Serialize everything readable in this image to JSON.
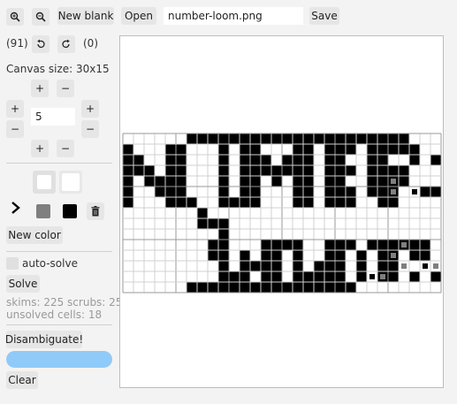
{
  "toolbar": {
    "zoom_in_icon": "zoom-in-icon",
    "zoom_out_icon": "zoom-out-icon",
    "new_blank_label": "New blank",
    "open_label": "Open",
    "filename_value": "number-loom.png",
    "save_label": "Save"
  },
  "history": {
    "undo_count": "(91)",
    "redo_count": "(0)"
  },
  "canvas_size": {
    "label": "Canvas size: 30x15",
    "resize_amount": "5",
    "plus": "+",
    "minus": "−"
  },
  "palette": {
    "colors": [
      "#ffffff",
      "#ffffff",
      "#7f7f7f",
      "#000000"
    ],
    "selected_marker": "›",
    "new_color_label": "New color"
  },
  "solver": {
    "auto_solve_label": "auto-solve",
    "auto_solve_checked": false,
    "solve_label": "Solve",
    "stats_line1": "skims: 225 scrubs: 25",
    "stats_line2": "unsolved cells: 18",
    "disambiguate_label": "Disambiguate!",
    "progress": 1.0,
    "clear_label": "Clear"
  },
  "colors": {
    "progress_bar": "#90caf9",
    "cell_black": "#000000",
    "cell_gray": "#7f7f7f",
    "cell_light": "#cccccc"
  },
  "grid": {
    "width": 30,
    "height": 15,
    "rows": [
      "000000000000000000000000000000",
      "100011000101100011011101111100",
      "110011000101110111011001100101",
      "111011000101111111011101111000",
      "101111000101101011011001111000",
      "100111000101100011011101110011",
      "100011100111100011011100110000",
      "000000010000000000000000000000",
      "000000011100000000000000000000",
      "000000000100000000000000000000",
      "000000001100011110011101111110",
      "000000001101011010011010110110",
      "000000000101111010111010110000",
      "000000000111011011111010110101",
      "000000000000000000000000000000"
    ],
    "top_row": "000000111111111111111111111000",
    "bottom_row": "000000111111111111111100000000"
  }
}
